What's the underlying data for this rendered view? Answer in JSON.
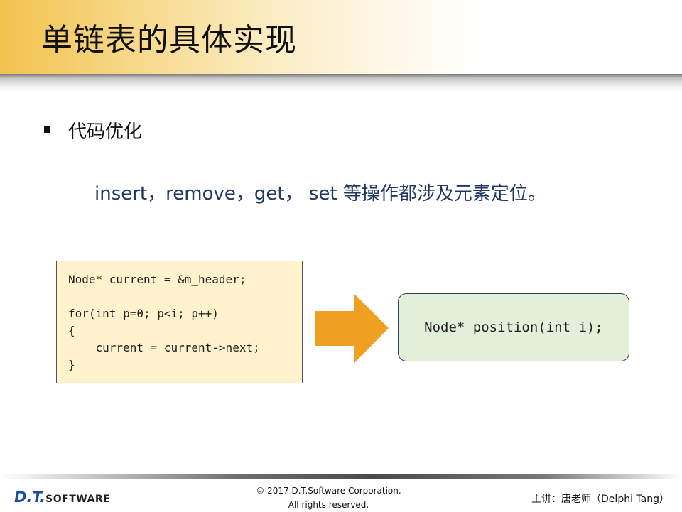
{
  "slide": {
    "title": "单链表的具体实现",
    "bullet": "代码优化",
    "subtext": "insert，remove，get， set 等操作都涉及元素定位。"
  },
  "code_left": {
    "lines": [
      "Node* current = &m_header;",
      "",
      "for(int p=0; p<i; p++)",
      "{",
      "    current = current->next;",
      "}"
    ]
  },
  "code_right": {
    "text": "Node* position(int i);"
  },
  "colors": {
    "code_box_bg": "#fff2cc",
    "result_box_bg": "#e2efd9",
    "arrow": "#f0a020",
    "subtext": "#1f3864"
  },
  "footer": {
    "logo_dt": "D.T.",
    "logo_software": "SOFTWARE",
    "copyright_line1": "© 2017 D.T.Software Corporation.",
    "copyright_line2": "All rights reserved.",
    "presenter": "主讲：唐老师（Delphi Tang）"
  }
}
